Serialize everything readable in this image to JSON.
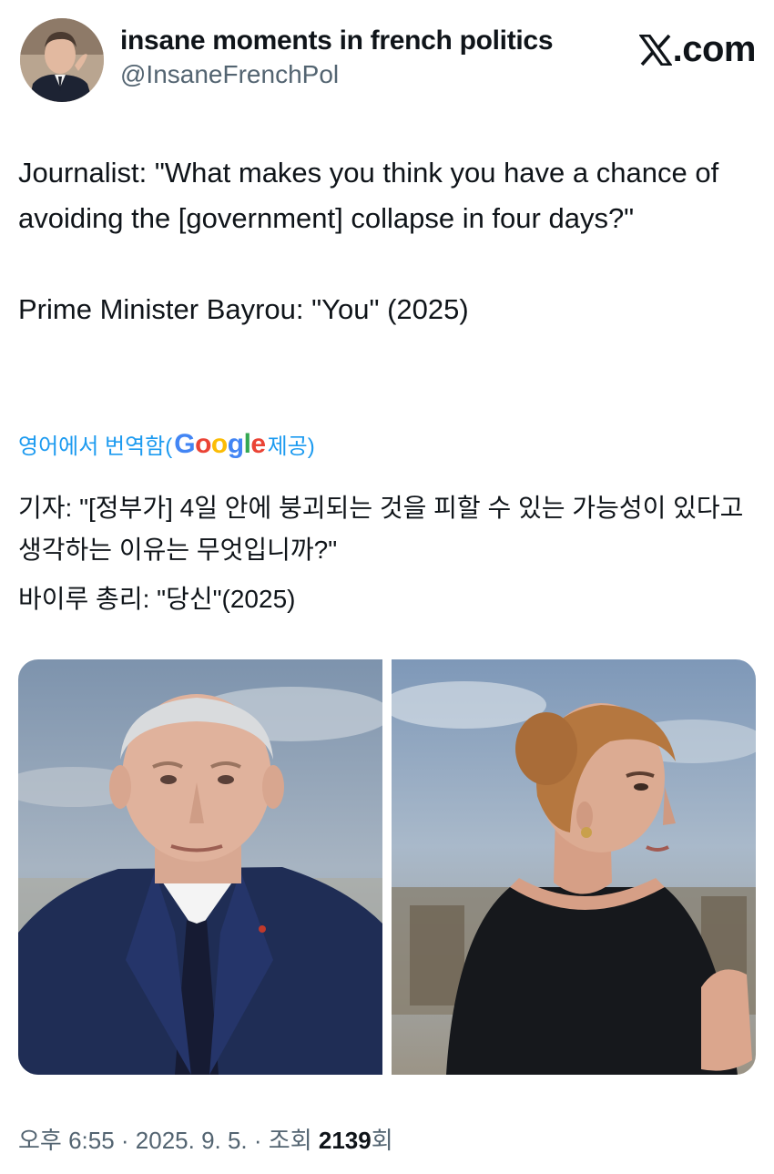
{
  "header": {
    "display_name": "insane moments in french politics",
    "handle": "@InsaneFrenchPol",
    "site": ".com"
  },
  "tweet": {
    "line1": "Journalist: \"What makes you think you have a chance of avoiding the [government] collapse in four days?\"",
    "line2": "Prime Minister Bayrou: \"You\" (2025)"
  },
  "translation": {
    "prefix": "영어에서 번역함(",
    "google": [
      "G",
      "o",
      "o",
      "g",
      "l",
      "e"
    ],
    "suffix": " 제공)",
    "line1": "기자: \"[정부가] 4일 안에 붕괴되는 것을 피할 수 있는 가능성이 있다고 생각하는 이유는 무엇입니까?\"",
    "line2": "바이루 총리: \"당신\"(2025)"
  },
  "meta": {
    "time": "오후 6:55",
    "sep1": " · ",
    "date": "2025. 9. 5.",
    "sep2": " · ",
    "views_label": "조회 ",
    "views_count": "2139",
    "views_suffix": "회"
  },
  "icons": {
    "logo": "x-logo-icon"
  },
  "colors": {
    "link": "#1d9bf0",
    "muted": "#536471",
    "text": "#0f1419"
  }
}
